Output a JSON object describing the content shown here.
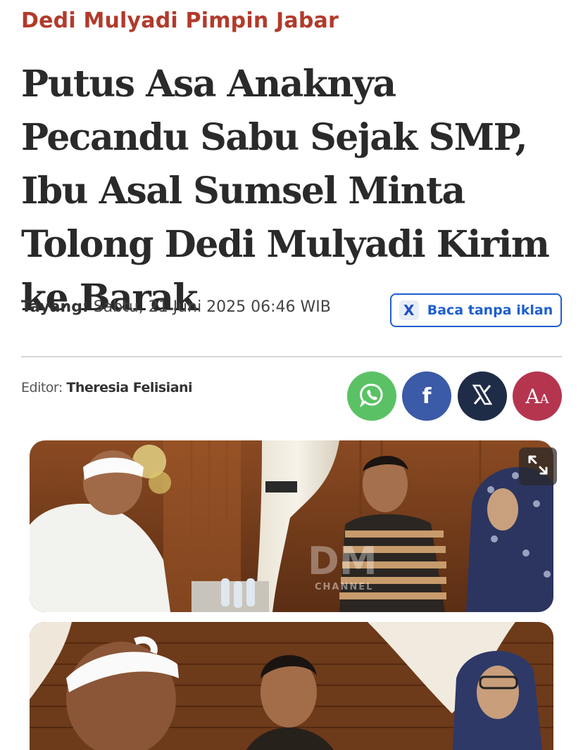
{
  "kicker": "Dedi Mulyadi Pimpin Jabar",
  "headline": "Putus Asa Anaknya Pecandu Sabu Sejak SMP, Ibu Asal Sumsel Minta Tolong Dedi Mulyadi Kirim ke Barak",
  "published": {
    "label": "Tayang:",
    "value": "Sabtu, 21 Juni 2025 06:46 WIB"
  },
  "ad_free_button": {
    "icon": "x-logo-icon",
    "label": "Baca tanpa iklan"
  },
  "editor": {
    "label": "Editor:",
    "name": "Theresia Felisiani"
  },
  "share": [
    {
      "name": "whatsapp",
      "icon": "whatsapp-icon",
      "color": "#5ac265"
    },
    {
      "name": "facebook",
      "icon": "facebook-icon",
      "glyph": "f",
      "color": "#3b5aa8"
    },
    {
      "name": "x",
      "icon": "x-icon",
      "glyph": "X",
      "color": "#1f2c48"
    },
    {
      "name": "font-size",
      "icon": "font-size-icon",
      "glyph": "A",
      "glyph_small": "A",
      "color": "#b5354f"
    }
  ],
  "photos": [
    {
      "watermark_line1": "DM",
      "watermark_line2": "CHANNEL"
    },
    {
      "watermark_line1": "",
      "watermark_line2": ""
    }
  ],
  "colors": {
    "kicker": "#b23a2b",
    "accent_blue": "#1f5fd0"
  }
}
